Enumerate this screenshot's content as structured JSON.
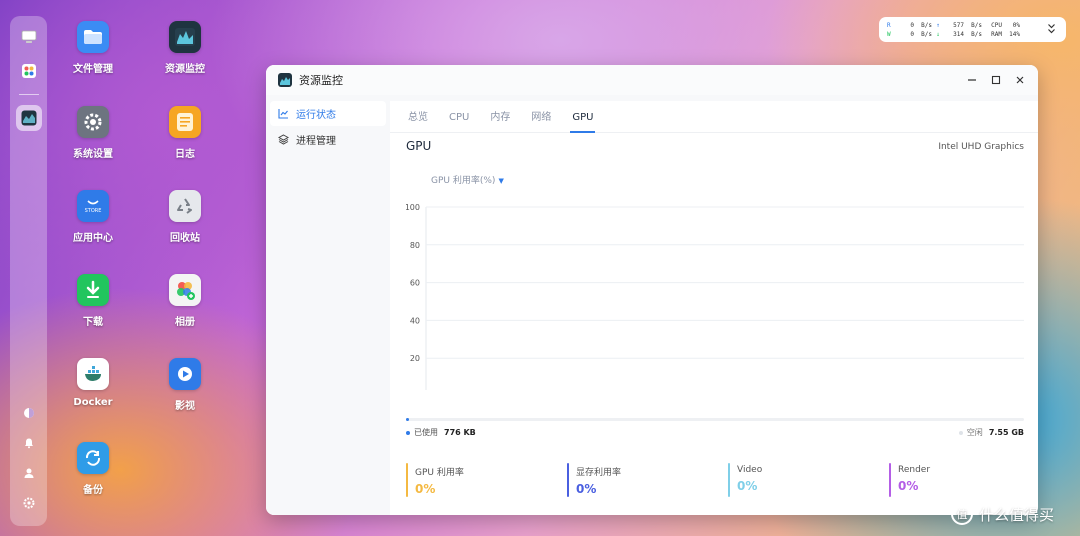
{
  "desktop": {
    "icons": [
      {
        "label": "文件管理",
        "icon": "folder-icon",
        "color": "#3b8cf4"
      },
      {
        "label": "资源监控",
        "icon": "resource-monitor-icon",
        "color": "#1f3440"
      },
      {
        "label": "系统设置",
        "icon": "gear-icon",
        "color": "#6d7480"
      },
      {
        "label": "日志",
        "icon": "log-icon",
        "color": "#f6a623"
      },
      {
        "label": "应用中心",
        "icon": "store-icon",
        "color": "#2f7be8"
      },
      {
        "label": "回收站",
        "icon": "recycle-icon",
        "color": "#d9dde3"
      },
      {
        "label": "下载",
        "icon": "download-icon",
        "color": "#22c55e"
      },
      {
        "label": "相册",
        "icon": "photos-icon",
        "color": "#f0f0f0"
      },
      {
        "label": "Docker",
        "icon": "docker-icon",
        "color": "#ffffff"
      },
      {
        "label": "影视",
        "icon": "video-icon",
        "color": "#2f7be8"
      },
      {
        "label": "备份",
        "icon": "backup-icon",
        "color": "#2f9ce8"
      }
    ]
  },
  "sysmon": {
    "r_label": "R",
    "w_label": "W",
    "r_read": "0",
    "r_unit": "B/s",
    "r_write": "577",
    "r_write_unit": "B/s",
    "w_read": "0",
    "w_unit": "B/s",
    "w_write": "314",
    "w_write_unit": "B/s",
    "cpu_label": "CPU",
    "cpu_value": "0%",
    "ram_label": "RAM",
    "ram_value": "14%"
  },
  "window": {
    "title": "资源监控",
    "sidebar": [
      {
        "label": "运行状态",
        "icon": "chart-line-icon",
        "active": true
      },
      {
        "label": "进程管理",
        "icon": "layers-icon",
        "active": false
      }
    ],
    "tabs": [
      {
        "label": "总览",
        "active": false
      },
      {
        "label": "CPU",
        "active": false
      },
      {
        "label": "内存",
        "active": false
      },
      {
        "label": "网络",
        "active": false
      },
      {
        "label": "GPU",
        "active": true
      }
    ],
    "gpu_title": "GPU",
    "gpu_name": "Intel UHD Graphics",
    "metric_select": "GPU 利用率(%)",
    "memory": {
      "used_label": "已使用",
      "used_value": "776 KB",
      "free_label": "空闲",
      "free_value": "7.55 GB",
      "used_fraction": 0.0001
    },
    "stats": [
      {
        "name": "GPU 利用率",
        "value": "0%",
        "color": "#f4b942"
      },
      {
        "name": "显存利用率",
        "value": "0%",
        "color": "#4a5fe0"
      },
      {
        "name": "Video",
        "value": "0%",
        "color": "#7fcfe8"
      },
      {
        "name": "Render",
        "value": "0%",
        "color": "#b45ee6"
      }
    ]
  },
  "chart_data": {
    "type": "line",
    "title": "",
    "xlabel": "",
    "ylabel": "GPU 利用率(%)",
    "ylim": [
      0,
      100
    ],
    "yticks": [
      100,
      80,
      60,
      40,
      20
    ],
    "grid": true,
    "series": [
      {
        "color": "#f4b942",
        "x": [
          0.25,
          1.0
        ],
        "values": [
          0,
          0
        ]
      }
    ]
  },
  "watermark": "什么值得买"
}
